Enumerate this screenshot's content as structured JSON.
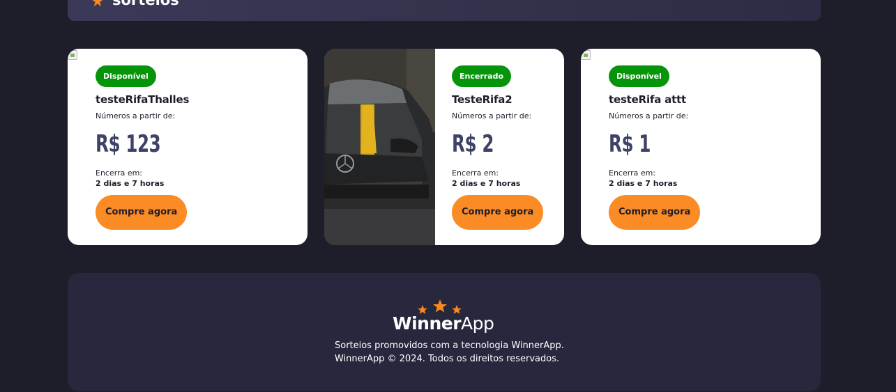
{
  "header": {
    "title": "sorteios",
    "star_icon": "star-icon",
    "accent_color": "#f7891f"
  },
  "raffles": [
    {
      "status": "Disponível",
      "title": "testeRifaThalles",
      "from_label": "Números a partir de:",
      "price": "R$ 123",
      "ends_label": "Encerra em:",
      "ends_value": "2 dias e 7 horas",
      "button": "Compre agora"
    },
    {
      "status": "Encerrado",
      "title": "TesteRifa2",
      "from_label": "Números a partir de:",
      "price": "R$ 2",
      "ends_label": "Encerra em:",
      "ends_value": "2 dias e 7 horas",
      "button": "Compre agora"
    },
    {
      "status": "Disponível",
      "title": "testeRifa attt",
      "from_label": "Números a partir de:",
      "price": "R$ 1",
      "ends_label": "Encerra em:",
      "ends_value": "2 dias e 7 horas",
      "button": "Compre agora"
    }
  ],
  "footer": {
    "logo_bold": "Winner",
    "logo_light": "App",
    "line1": "Sorteios promovidos com a tecnologia WinnerApp.",
    "line2": "WinnerApp © 2024. Todos os direitos reservados."
  },
  "colors": {
    "background": "#1e1e2b",
    "badge_green": "#06940b",
    "button_orange": "#fb8b24",
    "price_color": "#3d4266"
  }
}
